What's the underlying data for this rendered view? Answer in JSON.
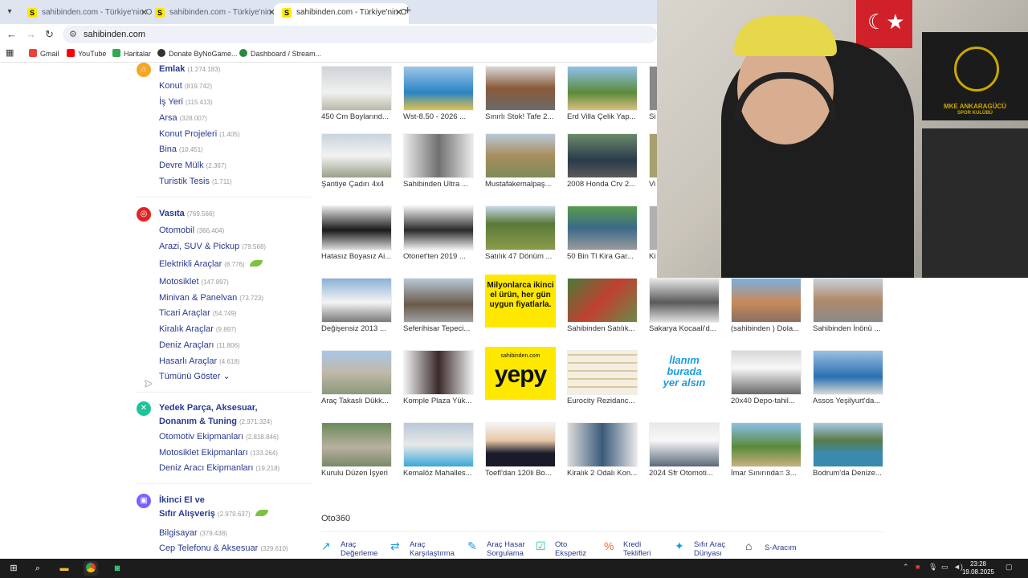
{
  "browser": {
    "tabs": [
      {
        "title": "sahibinden.com - Türkiye'nin O",
        "favicon": "S",
        "active": false
      },
      {
        "title": "sahibinden.com - Türkiye'nin O",
        "favicon": "S",
        "active": false
      },
      {
        "title": "sahibinden.com - Türkiye'nin O",
        "favicon": "S",
        "active": true
      }
    ],
    "address": "sahibinden.com",
    "bookmarks": [
      "Gmail",
      "YouTube",
      "Haritalar",
      "Donate ByNoGame...",
      "Dashboard / Stream..."
    ]
  },
  "sidebar": {
    "emlak": {
      "title": "Emlak",
      "count": "(1.274.183)",
      "items": [
        {
          "label": "Konut",
          "count": "(819.742)"
        },
        {
          "label": "İş Yeri",
          "count": "(115.413)"
        },
        {
          "label": "Arsa",
          "count": "(328.007)"
        },
        {
          "label": "Konut Projeleri",
          "count": "(1.405)"
        },
        {
          "label": "Bina",
          "count": "(10.451)"
        },
        {
          "label": "Devre Mülk",
          "count": "(2.367)"
        },
        {
          "label": "Turistik Tesis",
          "count": "(1.711)"
        }
      ]
    },
    "vasita": {
      "title": "Vasıta",
      "count": "(769.566)",
      "items": [
        {
          "label": "Otomobil",
          "count": "(366.404)"
        },
        {
          "label": "Arazi, SUV & Pickup",
          "count": "(79.568)"
        },
        {
          "label": "Elektrikli Araçlar",
          "count": "(8.776)"
        },
        {
          "label": "Motosiklet",
          "count": "(147.897)"
        },
        {
          "label": "Minivan & Panelvan",
          "count": "(73.723)"
        },
        {
          "label": "Ticari Araçlar",
          "count": "(54.749)"
        },
        {
          "label": "Kiralık Araçlar",
          "count": "(9.897)"
        },
        {
          "label": "Deniz Araçları",
          "count": "(11.806)"
        },
        {
          "label": "Hasarlı Araçlar",
          "count": "(4.618)"
        }
      ],
      "show_all": "Tümünü Göster"
    },
    "yedek": {
      "title_line1": "Yedek Parça, Aksesuar,",
      "title_line2": "Donanım & Tuning",
      "count": "(2.971.324)",
      "items": [
        {
          "label": "Otomotiv Ekipmanları",
          "count": "(2.818.846)"
        },
        {
          "label": "Motosiklet Ekipmanları",
          "count": "(133.264)"
        },
        {
          "label": "Deniz Aracı Ekipmanları",
          "count": "(19.218)"
        }
      ]
    },
    "ikinci": {
      "title_line1": "İkinci El ve",
      "title_line2": "Sıfır Alışveriş",
      "count": "(2.979.637)",
      "items": [
        {
          "label": "Bilgisayar",
          "count": "(379.438)"
        },
        {
          "label": "Cep Telefonu & Aksesuar",
          "count": "(329.610)"
        }
      ]
    }
  },
  "listings": [
    [
      "450 Cm Boylarınd...",
      "Wst-8.50 - 2026 ...",
      "Sınırlı Stok! Tafe 2...",
      "Erd Villa Çelik Yap...",
      "Si"
    ],
    [
      "Şantiye Çadırı 4x4",
      "Sahibinden Ultra ...",
      "Mustafakemalpaş...",
      "2008 Honda Crv 2...",
      "Vi"
    ],
    [
      "Hatasız Boyasız Ai...",
      "Otonet'ten 2019 ...",
      "Satılık 47 Dönüm ...",
      "50 Bin Tl Kira Gar...",
      "Ki"
    ],
    [
      "Değişensiz 2013 ...",
      "Seferihisar Tepeci...",
      "",
      "Sahibinden Satılık...",
      "Sakarya Kocaali'd...",
      "(sahibinden ) Dola...",
      "Sahibinden İnönü ..."
    ],
    [
      "Araç Takaslı Dükk...",
      "Komple Plaza Yük...",
      "",
      "Eurocity Rezidanc...",
      "",
      "20x40 Depo-tahil...",
      "Assos Yeşilyurt'da..."
    ],
    [
      "Kurulu Düzen İşyeri",
      "Kemalöz Mahalles...",
      "Toefl'dan 120li Bo...",
      "Kiralık 2 Odalı Kon...",
      "2024 Sfr Otomoti...",
      "İmar Sınırında= 3...",
      "Bodrum'da Denize..."
    ]
  ],
  "ads": {
    "milyonlarca": "Milyonlarca ikinci el ürün, her gün uygun fiyatlarla.",
    "yepy_small": "sahibinden.com",
    "yepy": "yepy",
    "ilanim_line1": "İlanım",
    "ilanim_line2": "burada",
    "ilanim_line3": "yer alsın"
  },
  "oto360": {
    "title": "Oto360",
    "tools": [
      {
        "l1": "Araç",
        "l2": "Değerleme"
      },
      {
        "l1": "Araç",
        "l2": "Karşılaştırma"
      },
      {
        "l1": "Araç Hasar",
        "l2": "Sorgulama"
      },
      {
        "l1": "Oto",
        "l2": "Ekspertiz"
      },
      {
        "l1": "Kredi",
        "l2": "Teklifleri"
      },
      {
        "l1": "Sıfır Araç",
        "l2": "Dünyası"
      },
      {
        "l1": "S-Aracım",
        "l2": ""
      }
    ]
  },
  "webcam": {
    "poster_text": "MKE ANKARAGÜCÜ",
    "poster_sub": "SPOR KULÜBÜ"
  },
  "taskbar": {
    "time": "23:28",
    "date": "19.08.2025"
  },
  "colors": {
    "brand_yellow": "#ffe800",
    "link_blue": "#2a3a8f",
    "emlak": "#f5a623",
    "vasita": "#e02424",
    "yedek": "#1fc39a",
    "ikinci": "#7b61ff"
  }
}
